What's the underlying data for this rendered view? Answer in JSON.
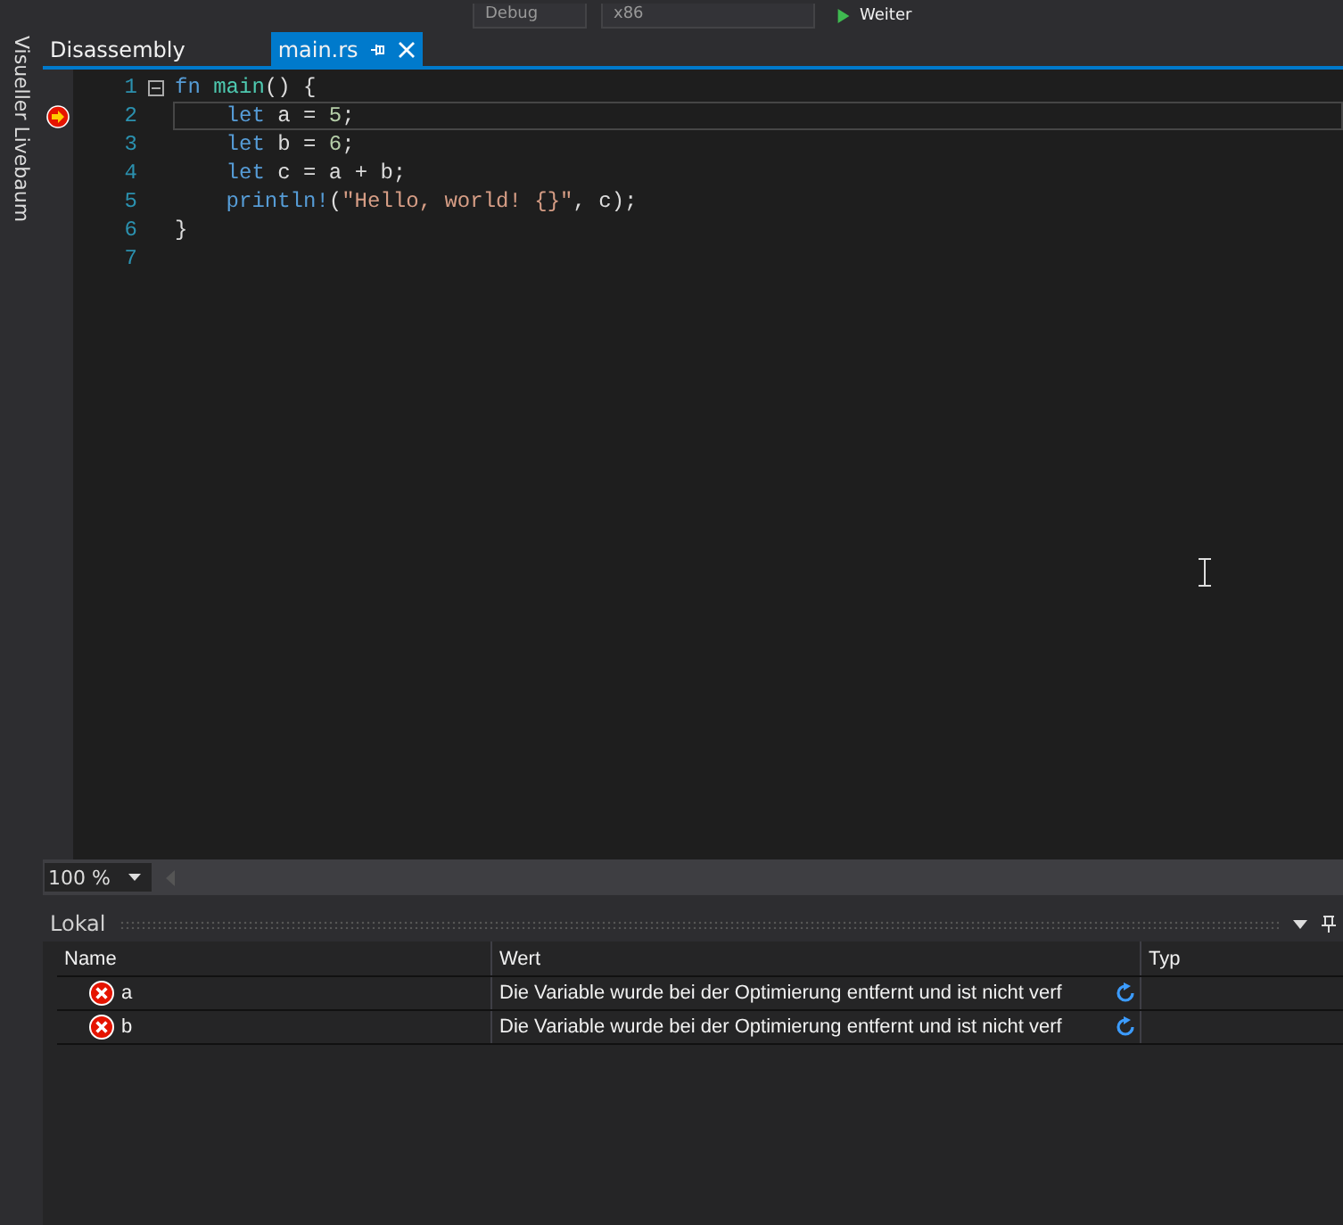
{
  "toolbar": {
    "configuration": "Debug",
    "platform": "x86",
    "continue_button": "Weiter"
  },
  "side_tab": "Visueller Livebaum",
  "tabs": [
    {
      "label": "Disassembly",
      "selected": false,
      "pinned": false
    },
    {
      "label": "main.rs",
      "selected": true,
      "pinned": true
    }
  ],
  "editor": {
    "lines": [
      {
        "number": "1",
        "current": false,
        "tokens": [
          {
            "kind": "keyword",
            "text": "fn"
          },
          {
            "kind": "function",
            "text": " main"
          },
          {
            "kind": "plain",
            "text": "() {"
          }
        ],
        "children": [
          {
            "number": "2",
            "current": true,
            "tokens": [
              {
                "kind": "keyword",
                "text": "let"
              },
              {
                "kind": "plain",
                "text": " a = "
              },
              {
                "kind": "number",
                "text": "5"
              },
              {
                "kind": "plain",
                "text": ";"
              }
            ]
          },
          {
            "number": "3",
            "current": false,
            "tokens": [
              {
                "kind": "keyword",
                "text": "let"
              },
              {
                "kind": "plain",
                "text": " b = "
              },
              {
                "kind": "number",
                "text": "6"
              },
              {
                "kind": "plain",
                "text": ";"
              }
            ]
          },
          {
            "number": "4",
            "current": false,
            "tokens": [
              {
                "kind": "keyword",
                "text": "let"
              },
              {
                "kind": "plain",
                "text": " c = a + b;"
              }
            ]
          },
          {
            "number": "5",
            "current": false,
            "tokens": [
              {
                "kind": "keyword",
                "text": "println!"
              },
              {
                "kind": "plain",
                "text": "("
              },
              {
                "kind": "string",
                "text": "\"Hello, world! {}\""
              },
              {
                "kind": "plain",
                "text": ", c);"
              }
            ]
          }
        ]
      },
      {
        "number": "6",
        "current": false,
        "tokens": [
          {
            "kind": "plain",
            "text": "}"
          }
        ]
      },
      {
        "number": "7",
        "current": false
      }
    ]
  },
  "zoom": "100 %",
  "locals": {
    "title": "Lokal",
    "columns": [
      "Name",
      "Wert",
      "Typ"
    ],
    "rows": [
      {
        "name": "a",
        "value": "Die Variable wurde bei der Optimierung entfernt und ist nicht verf"
      },
      {
        "name": "b",
        "value": "Die Variable wurde bei der Optimierung entfernt und ist nicht verf"
      }
    ]
  }
}
